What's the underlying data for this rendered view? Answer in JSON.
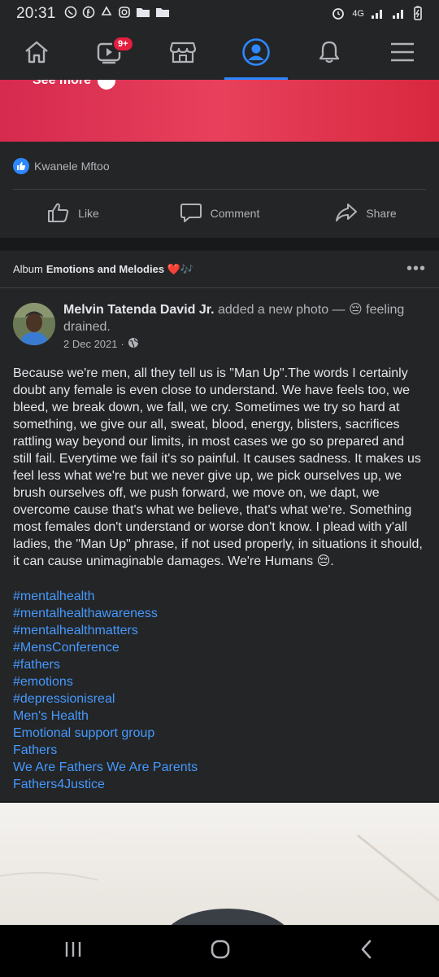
{
  "status_bar": {
    "time": "20:31",
    "network": "4G"
  },
  "nav": {
    "items": [
      {
        "name": "home",
        "icon": "home-icon"
      },
      {
        "name": "watch",
        "icon": "video-icon",
        "badge": "9+"
      },
      {
        "name": "marketplace",
        "icon": "store-icon"
      },
      {
        "name": "profile",
        "icon": "profile-icon",
        "active": true
      },
      {
        "name": "notifications",
        "icon": "bell-icon"
      },
      {
        "name": "menu",
        "icon": "menu-icon"
      }
    ],
    "accent": "#2d88ff"
  },
  "prev_post": {
    "see_more": "See more",
    "reaction_name": "Kwanele Mftoo",
    "actions": {
      "like": "Like",
      "comment": "Comment",
      "share": "Share"
    }
  },
  "post": {
    "album_prefix": "Album",
    "album_name": "Emotions and Melodies ❤️🎶",
    "author": "Melvin Tatenda David Jr.",
    "action_text": " added a new photo — 😔 feeling drained.",
    "date": "2 Dec 2021",
    "body": "Because we're men, all they tell us is \"Man Up\".The words I certainly doubt any female is even close to understand. We have feels too, we bleed, we break down, we fall, we cry. Sometimes we try so hard at something, we give our all, sweat, blood, energy, blisters, sacrifices rattling way beyond our limits, in most cases we go so prepared and still fail. Everytime we fail it's so painful. It causes sadness. It makes us feel less what we're but we never give up, we pick ourselves up, we brush ourselves off, we push forward, we move on, we dapt, we overcome cause that's what we believe, that's what we're. Something most females don't understand or worse don't know. I plead with y'all ladies, the \"Man Up\" phrase, if not used properly, in situations it should, it can cause unimaginable damages. We're Humans 😔.",
    "tags": [
      "#mentalhealth",
      "#mentalhealthawareness",
      "#mentalhealthmatters",
      "#MensConference",
      "#fathers",
      "#emotions",
      "#depressionisreal",
      "Men's Health",
      "Emotional support group",
      "Fathers",
      "We Are Fathers We Are Parents",
      "Fathers4Justice"
    ]
  }
}
